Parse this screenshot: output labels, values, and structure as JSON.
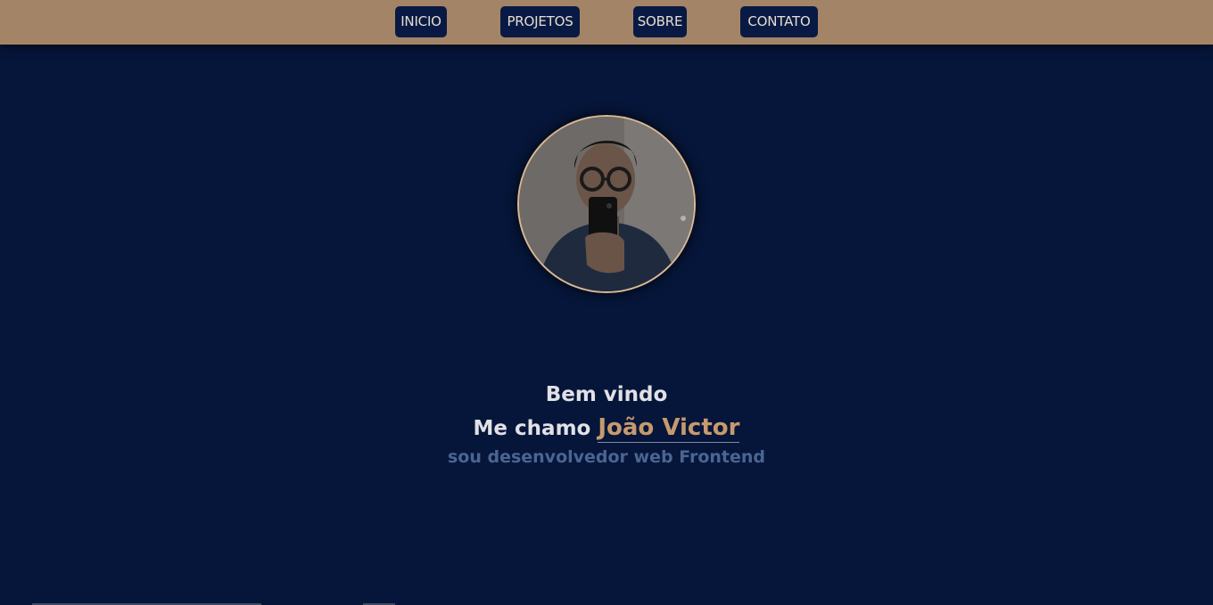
{
  "nav": {
    "items": [
      {
        "label": "INICIO"
      },
      {
        "label": "PROJETOS"
      },
      {
        "label": "SOBRE"
      },
      {
        "label": "CONTATO"
      }
    ]
  },
  "hero": {
    "avatar_icon": "profile-photo",
    "greeting": "Bem vindo",
    "intro_prefix": "Me chamo ",
    "name": "João Victor",
    "role": "sou desenvolvedor web Frontend"
  },
  "colors": {
    "topbar": "#a48467",
    "background": "#06163a",
    "button": "#081a44",
    "accent": "#c79a6e",
    "role_text": "#4b6591"
  }
}
